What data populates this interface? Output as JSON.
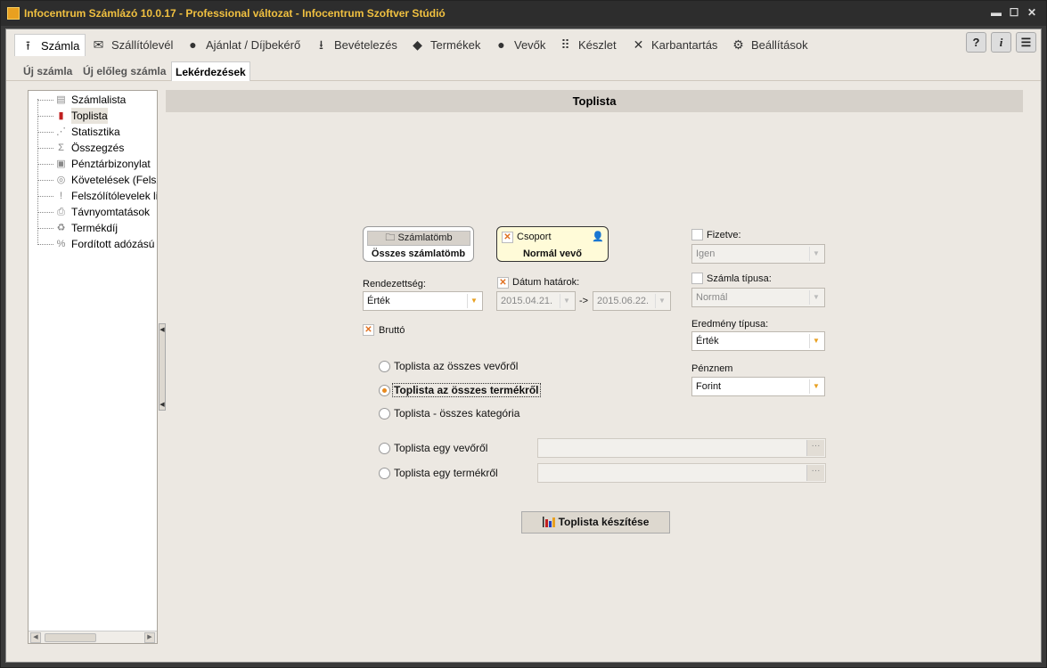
{
  "window": {
    "title": "Infocentrum Számlázó 10.0.17 - Professional változat - Infocentrum Szoftver Stúdió",
    "minimize": "▬",
    "maximize": "☐",
    "close": "✕"
  },
  "menu": {
    "items": [
      {
        "label": "Számla",
        "icon": "upload-icon"
      },
      {
        "label": "Szállítólevél",
        "icon": "envelope-icon"
      },
      {
        "label": "Ajánlat / Díjbekérő",
        "icon": "handshake-icon"
      },
      {
        "label": "Bevételezés",
        "icon": "download-icon"
      },
      {
        "label": "Termékek",
        "icon": "box-icon"
      },
      {
        "label": "Vevők",
        "icon": "user-icon"
      },
      {
        "label": "Készlet",
        "icon": "grid-icon"
      },
      {
        "label": "Karbantartás",
        "icon": "tools-icon"
      },
      {
        "label": "Beállítások",
        "icon": "gear-icon"
      }
    ],
    "help": "?",
    "info": "i",
    "list": "☰"
  },
  "subtabs": [
    "Új számla",
    "Új előleg számla",
    "Lekérdezések"
  ],
  "tree": {
    "items": [
      "Számlalista",
      "Toplista",
      "Statisztika",
      "Összegzés",
      "Pénztárbizonylat",
      "Követelések (Felsz",
      "Felszólítólevelek li",
      "Távnyomtatások",
      "Termékdíj",
      "Fordított adózású t"
    ]
  },
  "panel": {
    "title": "Toplista"
  },
  "cards": {
    "szamlatomb": {
      "button": "Számlatömb",
      "value": "Összes számlatömb"
    },
    "csoport": {
      "button": "Csoport",
      "value": "Normál vevő"
    }
  },
  "form": {
    "rendezettseg_label": "Rendezettség:",
    "rendezettseg_value": "Érték",
    "datum_label": "Dátum határok:",
    "datum_from": "2015.04.21.",
    "datum_arrow": "->",
    "datum_to": "2015.06.22.",
    "brutto_label": "Bruttó",
    "fizetve_label": "Fizetve:",
    "fizetve_value": "Igen",
    "szamla_tipusa_label": "Számla típusa:",
    "szamla_tipusa_value": "Normál",
    "eredmeny_tipusa_label": "Eredmény típusa:",
    "eredmeny_tipusa_value": "Érték",
    "penznem_label": "Pénznem",
    "penznem_value": "Forint"
  },
  "options": [
    "Toplista az összes vevőről",
    "Toplista az összes termékről",
    "Toplista - összes kategória",
    "Toplista egy vevőről",
    "Toplista egy termékről"
  ],
  "action": {
    "label": "Toplista készítése"
  },
  "colors": {
    "accent": "#e8a020",
    "title_text": "#f0c040"
  }
}
